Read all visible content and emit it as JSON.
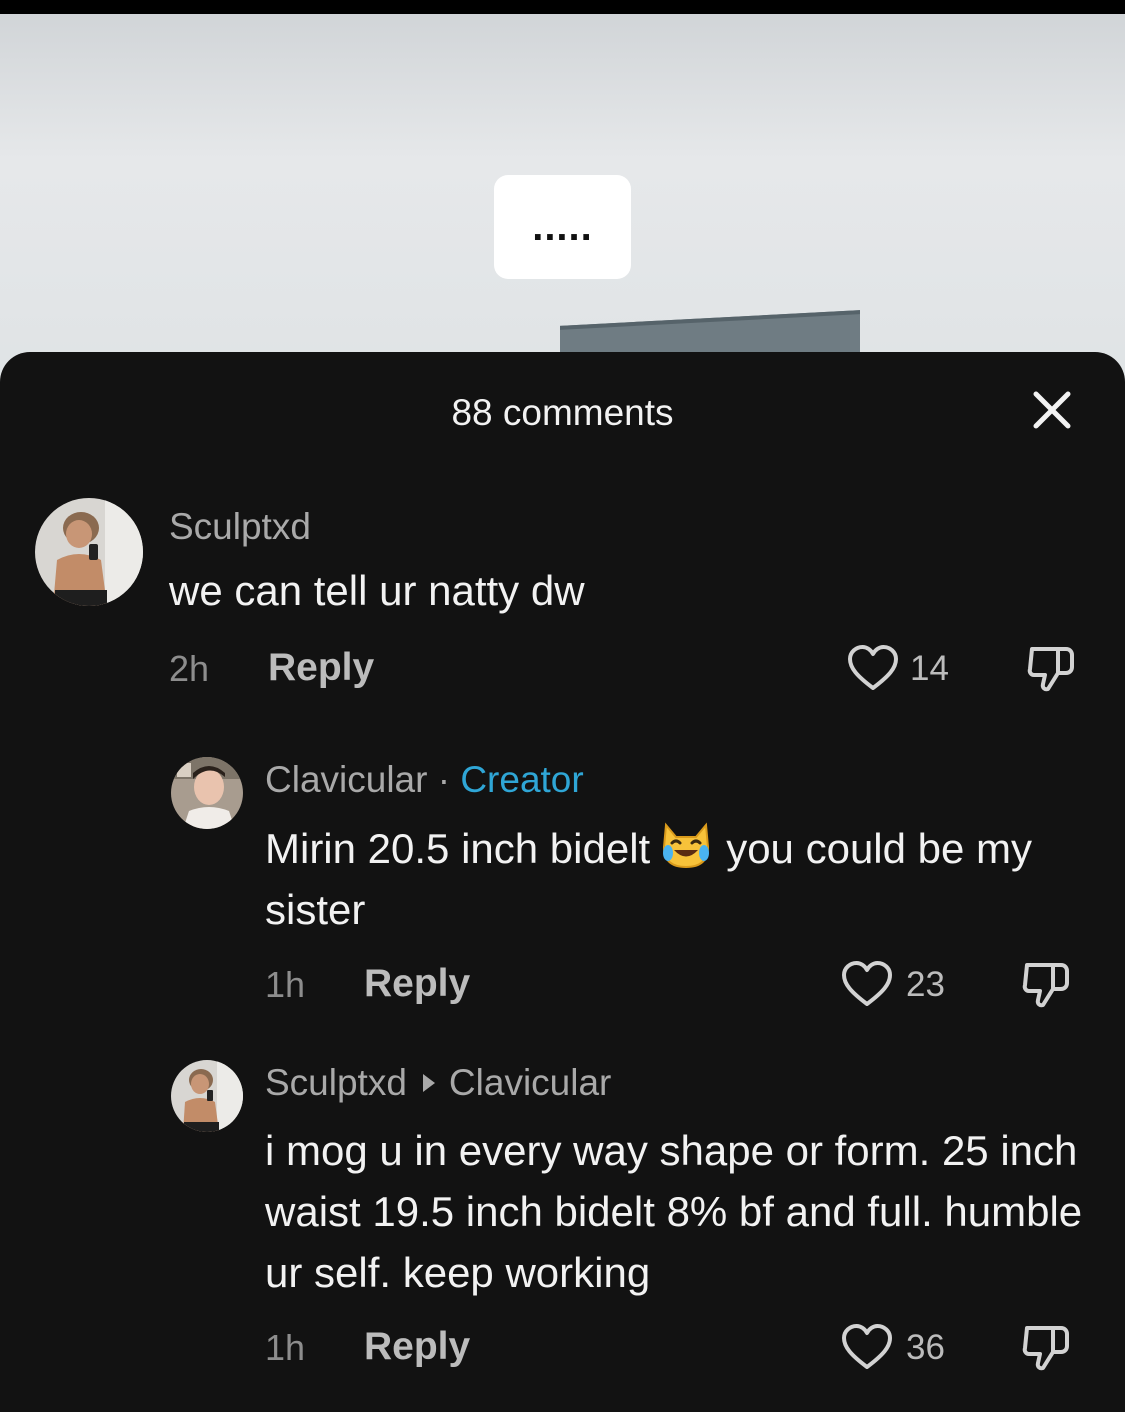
{
  "video": {
    "caption_text": "....."
  },
  "sheet": {
    "title": "88 comments",
    "close_icon": "close-icon"
  },
  "comments": [
    {
      "username": "Sculptxd",
      "text": "we can tell ur natty dw",
      "time": "2h",
      "reply_label": "Reply",
      "likes": "14"
    },
    {
      "username": "Clavicular",
      "separator": "·",
      "badge": "Creator",
      "text_before_emoji": "Mirin 20.5 inch bidelt",
      "emoji": "crying-laughing-cat-emoji",
      "text_after_emoji": "you could be my sister",
      "time": "1h",
      "reply_label": "Reply",
      "likes": "23"
    },
    {
      "username": "Sculptxd",
      "reply_to": "Clavicular",
      "text": "i mog u in every way shape or form. 25 inch waist 19.5 inch bidelt 8% bf and full. humble ur self. keep working",
      "time": "1h",
      "reply_label": "Reply",
      "likes": "36"
    }
  ],
  "colors": {
    "sheet_background": "#121212",
    "creator_badge": "#2fa6d6",
    "primary_text": "#f2f2f2",
    "secondary_text": "#a9a9a9"
  }
}
